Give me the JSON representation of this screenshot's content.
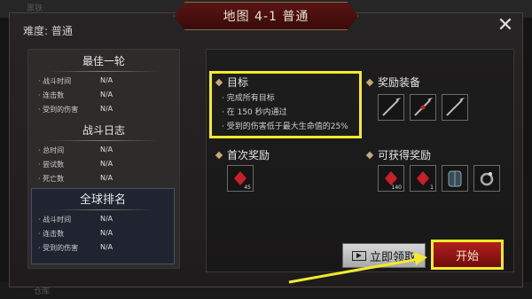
{
  "background": {
    "top_label": "黑铁",
    "bottom_label": "仓库"
  },
  "window": {
    "title": "地图 4-1 普通",
    "difficulty": "难度: 普通"
  },
  "best_round": {
    "title": "最佳一轮",
    "rows": [
      {
        "label": "战斗时间",
        "value": "N/A"
      },
      {
        "label": "连击数",
        "value": "N/A"
      },
      {
        "label": "受到的伤害",
        "value": "N/A"
      }
    ]
  },
  "battle_log": {
    "title": "战斗日志",
    "rows": [
      {
        "label": "总时间",
        "value": "N/A"
      },
      {
        "label": "尝试数",
        "value": "N/A"
      },
      {
        "label": "死亡数",
        "value": "N/A"
      }
    ]
  },
  "global_rank": {
    "title": "全球排名",
    "rows": [
      {
        "label": "战斗时间",
        "value": "N/A"
      },
      {
        "label": "连击数",
        "value": "N/A"
      },
      {
        "label": "受到的伤害",
        "value": "N/A"
      }
    ]
  },
  "objectives": {
    "title": "目标",
    "items": [
      "完成所有目标",
      "在 150 秒内通过",
      "受到的伤害低于最大生命值的25%"
    ]
  },
  "reward_equipment": {
    "title": "奖励装备",
    "items": [
      "spear-icon",
      "spear-icon",
      "spear-icon"
    ]
  },
  "first_reward": {
    "title": "首次奖励",
    "items": [
      {
        "icon": "red-gem-icon",
        "count": "45"
      }
    ]
  },
  "obtainable_rewards": {
    "title": "可获得奖励",
    "items": [
      {
        "icon": "red-gem-icon",
        "count": "140"
      },
      {
        "icon": "red-gem-icon",
        "count": "1"
      },
      {
        "icon": "armor-icon",
        "count": ""
      },
      {
        "icon": "ring-icon",
        "count": ""
      }
    ]
  },
  "buttons": {
    "claim": "立即领取",
    "start": "开始"
  },
  "colors": {
    "highlight": "#f2ea2a",
    "title_red": "#5a1414",
    "start_red": "#b41e1e"
  }
}
